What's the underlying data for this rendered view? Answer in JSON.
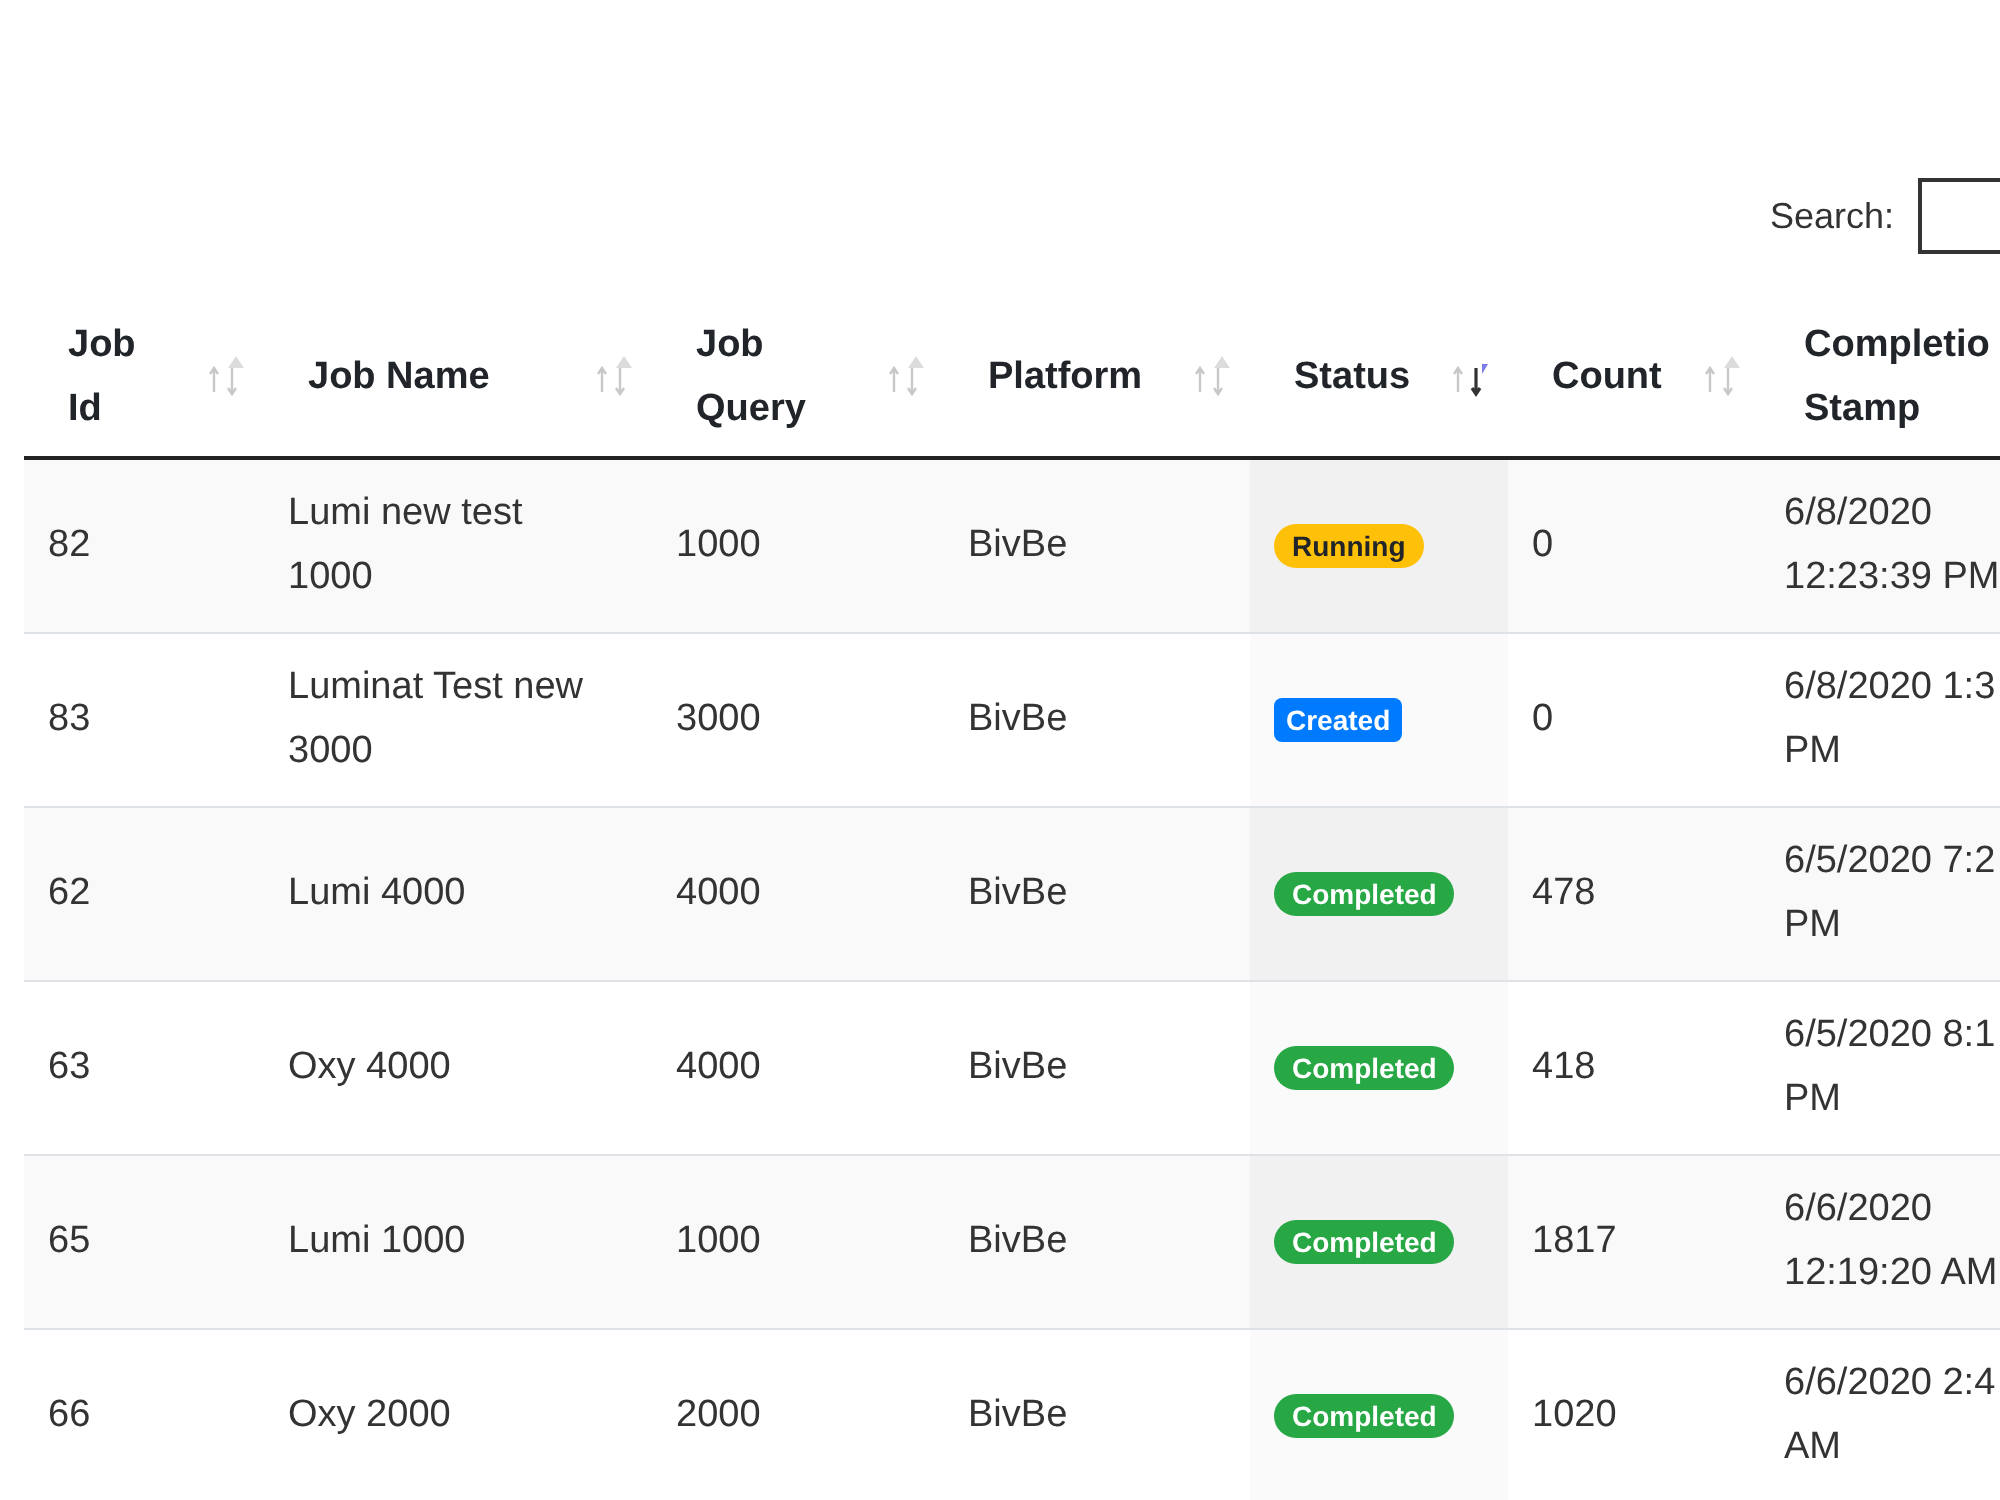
{
  "search": {
    "label": "Search:"
  },
  "table": {
    "columns": [
      {
        "lines": [
          "Job",
          "Id"
        ],
        "sorted": false
      },
      {
        "lines": [
          "Job Name"
        ],
        "sorted": false
      },
      {
        "lines": [
          "Job",
          "Query"
        ],
        "sorted": false
      },
      {
        "lines": [
          "Platform"
        ],
        "sorted": false
      },
      {
        "lines": [
          "Status"
        ],
        "sorted": true
      },
      {
        "lines": [
          "Count"
        ],
        "sorted": false
      },
      {
        "lines": [
          "Completio",
          "Stamp"
        ]
      }
    ],
    "rows": [
      {
        "id": "82",
        "name": [
          "Lumi new test",
          "1000"
        ],
        "query": "1000",
        "platform": "BivBe",
        "status": {
          "label": "Running",
          "kind": "running"
        },
        "count": "0",
        "stamp": [
          "6/8/2020",
          "12:23:39 PM"
        ]
      },
      {
        "id": "83",
        "name": [
          "Luminat Test new",
          "3000"
        ],
        "query": "3000",
        "platform": "BivBe",
        "status": {
          "label": "Created",
          "kind": "created"
        },
        "count": "0",
        "stamp": [
          "6/8/2020 1:3",
          "PM"
        ]
      },
      {
        "id": "62",
        "name": [
          "Lumi 4000"
        ],
        "query": "4000",
        "platform": "BivBe",
        "status": {
          "label": "Completed",
          "kind": "completed"
        },
        "count": "478",
        "stamp": [
          "6/5/2020 7:2",
          "PM"
        ]
      },
      {
        "id": "63",
        "name": [
          "Oxy 4000"
        ],
        "query": "4000",
        "platform": "BivBe",
        "status": {
          "label": "Completed",
          "kind": "completed"
        },
        "count": "418",
        "stamp": [
          "6/5/2020 8:1",
          "PM"
        ]
      },
      {
        "id": "65",
        "name": [
          "Lumi 1000"
        ],
        "query": "1000",
        "platform": "BivBe",
        "status": {
          "label": "Completed",
          "kind": "completed"
        },
        "count": "1817",
        "stamp": [
          "6/6/2020",
          "12:19:20 AM"
        ]
      },
      {
        "id": "66",
        "name": [
          "Oxy 2000"
        ],
        "query": "2000",
        "platform": "BivBe",
        "status": {
          "label": "Completed",
          "kind": "completed"
        },
        "count": "1020",
        "stamp": [
          "6/6/2020 2:4",
          "AM"
        ]
      }
    ]
  }
}
